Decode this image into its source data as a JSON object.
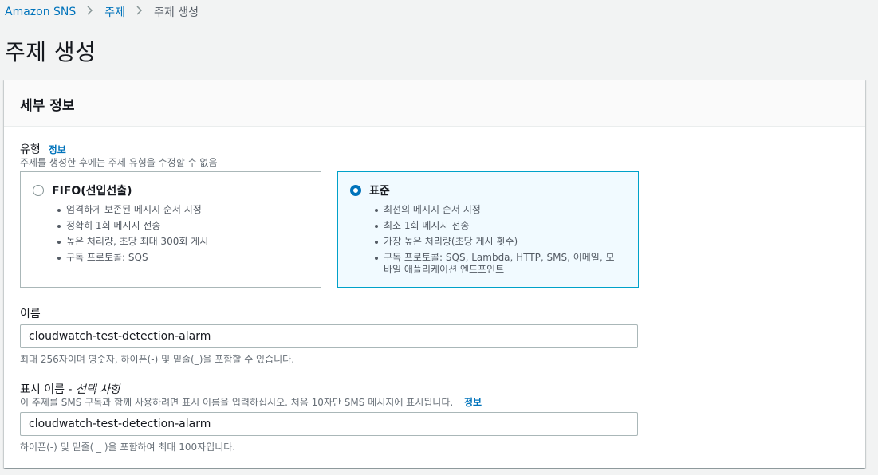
{
  "breadcrumb": {
    "items": [
      "Amazon SNS",
      "주제"
    ],
    "current": "주제 생성"
  },
  "page_title": "주제 생성",
  "card": {
    "title": "세부 정보",
    "type_field": {
      "label": "유형",
      "info": "정보",
      "description": "주제를 생성한 후에는 주제 유형을 수정할 수 없음",
      "options": [
        {
          "title": "FIFO(선입선출)",
          "selected": false,
          "bullets": [
            "엄격하게 보존된 메시지 순서 지정",
            "정확히 1회 메시지 전송",
            "높은 처리량, 초당 최대 300회 게시",
            "구독 프로토콜: SQS"
          ]
        },
        {
          "title": "표준",
          "selected": true,
          "bullets": [
            "최선의 메시지 순서 지정",
            "최소 1회 메시지 전송",
            "가장 높은 처리량(초당 게시 횟수)",
            "구독 프로토콜: SQS, Lambda, HTTP, SMS, 이메일, 모바일 애플리케이션 엔드포인트"
          ]
        }
      ]
    },
    "name_field": {
      "label": "이름",
      "value": "cloudwatch-test-detection-alarm",
      "hint": "최대 256자이며 영숫자, 하이픈(-) 및 밑줄(_)을 포함할 수 있습니다."
    },
    "display_name_field": {
      "label": "표시 이름 - ",
      "optional": "선택 사항",
      "description": "이 주제를 SMS 구독과 함께 사용하려면 표시 이름을 입력하십시오. 처음 10자만 SMS 메시지에 표시됩니다.",
      "info": "정보",
      "value": "cloudwatch-test-detection-alarm",
      "hint": "하이픈(-) 및 밑줄( _ )을 포함하여 최대 100자입니다."
    }
  },
  "colors": {
    "link": "#0073bb",
    "selected_border": "#00a1c9",
    "selected_bg": "#f1faff"
  }
}
